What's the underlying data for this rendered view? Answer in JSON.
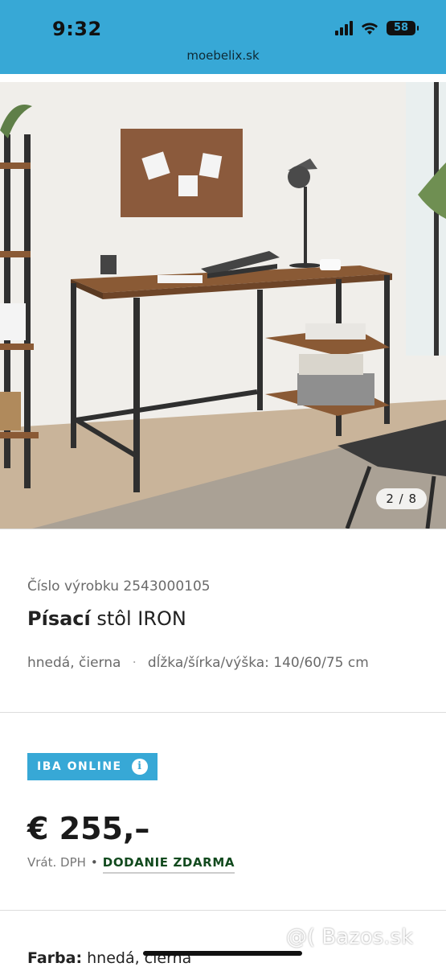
{
  "status": {
    "time": "9:32",
    "battery": "58"
  },
  "browser": {
    "url": "moebelix.sk"
  },
  "gallery": {
    "counter": "2 / 8"
  },
  "product": {
    "article_label": "Číslo výrobku",
    "article_number": "2543000105",
    "title_bold": "Písací",
    "title_rest": " stôl IRON",
    "color": "hnedá, čierna",
    "dimensions": "dĺžka/šírka/výška: 140/60/75 cm",
    "badge": "IBA ONLINE",
    "price": "€ 255,–",
    "vat": "Vrát. DPH",
    "delivery": "DODANIE ZDARMA",
    "color_label": "Farba:",
    "color_value": " hnedá, čierna"
  },
  "watermark": "@( Bazos.sk",
  "colors": {
    "accent": "#37a8d6",
    "delivery": "#124a1e"
  }
}
